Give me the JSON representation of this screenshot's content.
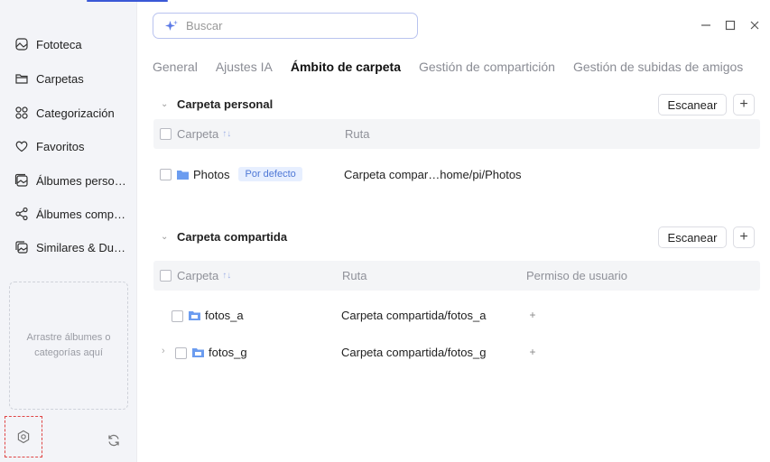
{
  "sidebar": {
    "items": [
      {
        "label": "Fototeca",
        "icon": "photo-library-icon"
      },
      {
        "label": "Carpetas",
        "icon": "folder-icon"
      },
      {
        "label": "Categorización",
        "icon": "category-grid-icon"
      },
      {
        "label": "Favoritos",
        "icon": "heart-icon"
      },
      {
        "label": "Álbumes personales",
        "icon": "album-icon"
      },
      {
        "label": "Álbumes compartidos",
        "icon": "share-icon"
      },
      {
        "label": "Similares & Duplicados",
        "icon": "similar-photos-icon"
      }
    ],
    "dropzone_text": "Arrastre álbumes o categorías aquí"
  },
  "search": {
    "placeholder": "Buscar"
  },
  "tabs": [
    {
      "label": "General",
      "active": false
    },
    {
      "label": "Ajustes IA",
      "active": false
    },
    {
      "label": "Ámbito de carpeta",
      "active": true
    },
    {
      "label": "Gestión de compartición",
      "active": false
    },
    {
      "label": "Gestión de subidas de amigos",
      "active": false
    }
  ],
  "personal": {
    "title": "Carpeta personal",
    "scan_label": "Escanear",
    "columns": {
      "folder": "Carpeta",
      "sort_mark": "↑↓",
      "path": "Ruta"
    },
    "rows": [
      {
        "name": "Photos",
        "badge": "Por defecto",
        "path": "Carpeta compar…home/pi/Photos"
      }
    ]
  },
  "shared": {
    "title": "Carpeta compartida",
    "scan_label": "Escanear",
    "columns": {
      "folder": "Carpeta",
      "sort_mark": "↑↓",
      "path": "Ruta",
      "permission": "Permiso de usuario"
    },
    "rows": [
      {
        "name": "fotos_a",
        "path": "Carpeta compartida/fotos_a"
      },
      {
        "name": "fotos_g",
        "path": "Carpeta compartida/fotos_g"
      }
    ]
  },
  "colors": {
    "accent": "#3a58d6",
    "sidebar_bg": "#f3f4f8",
    "highlight_dashed": "#e04646",
    "badge_bg": "#e7efff"
  }
}
